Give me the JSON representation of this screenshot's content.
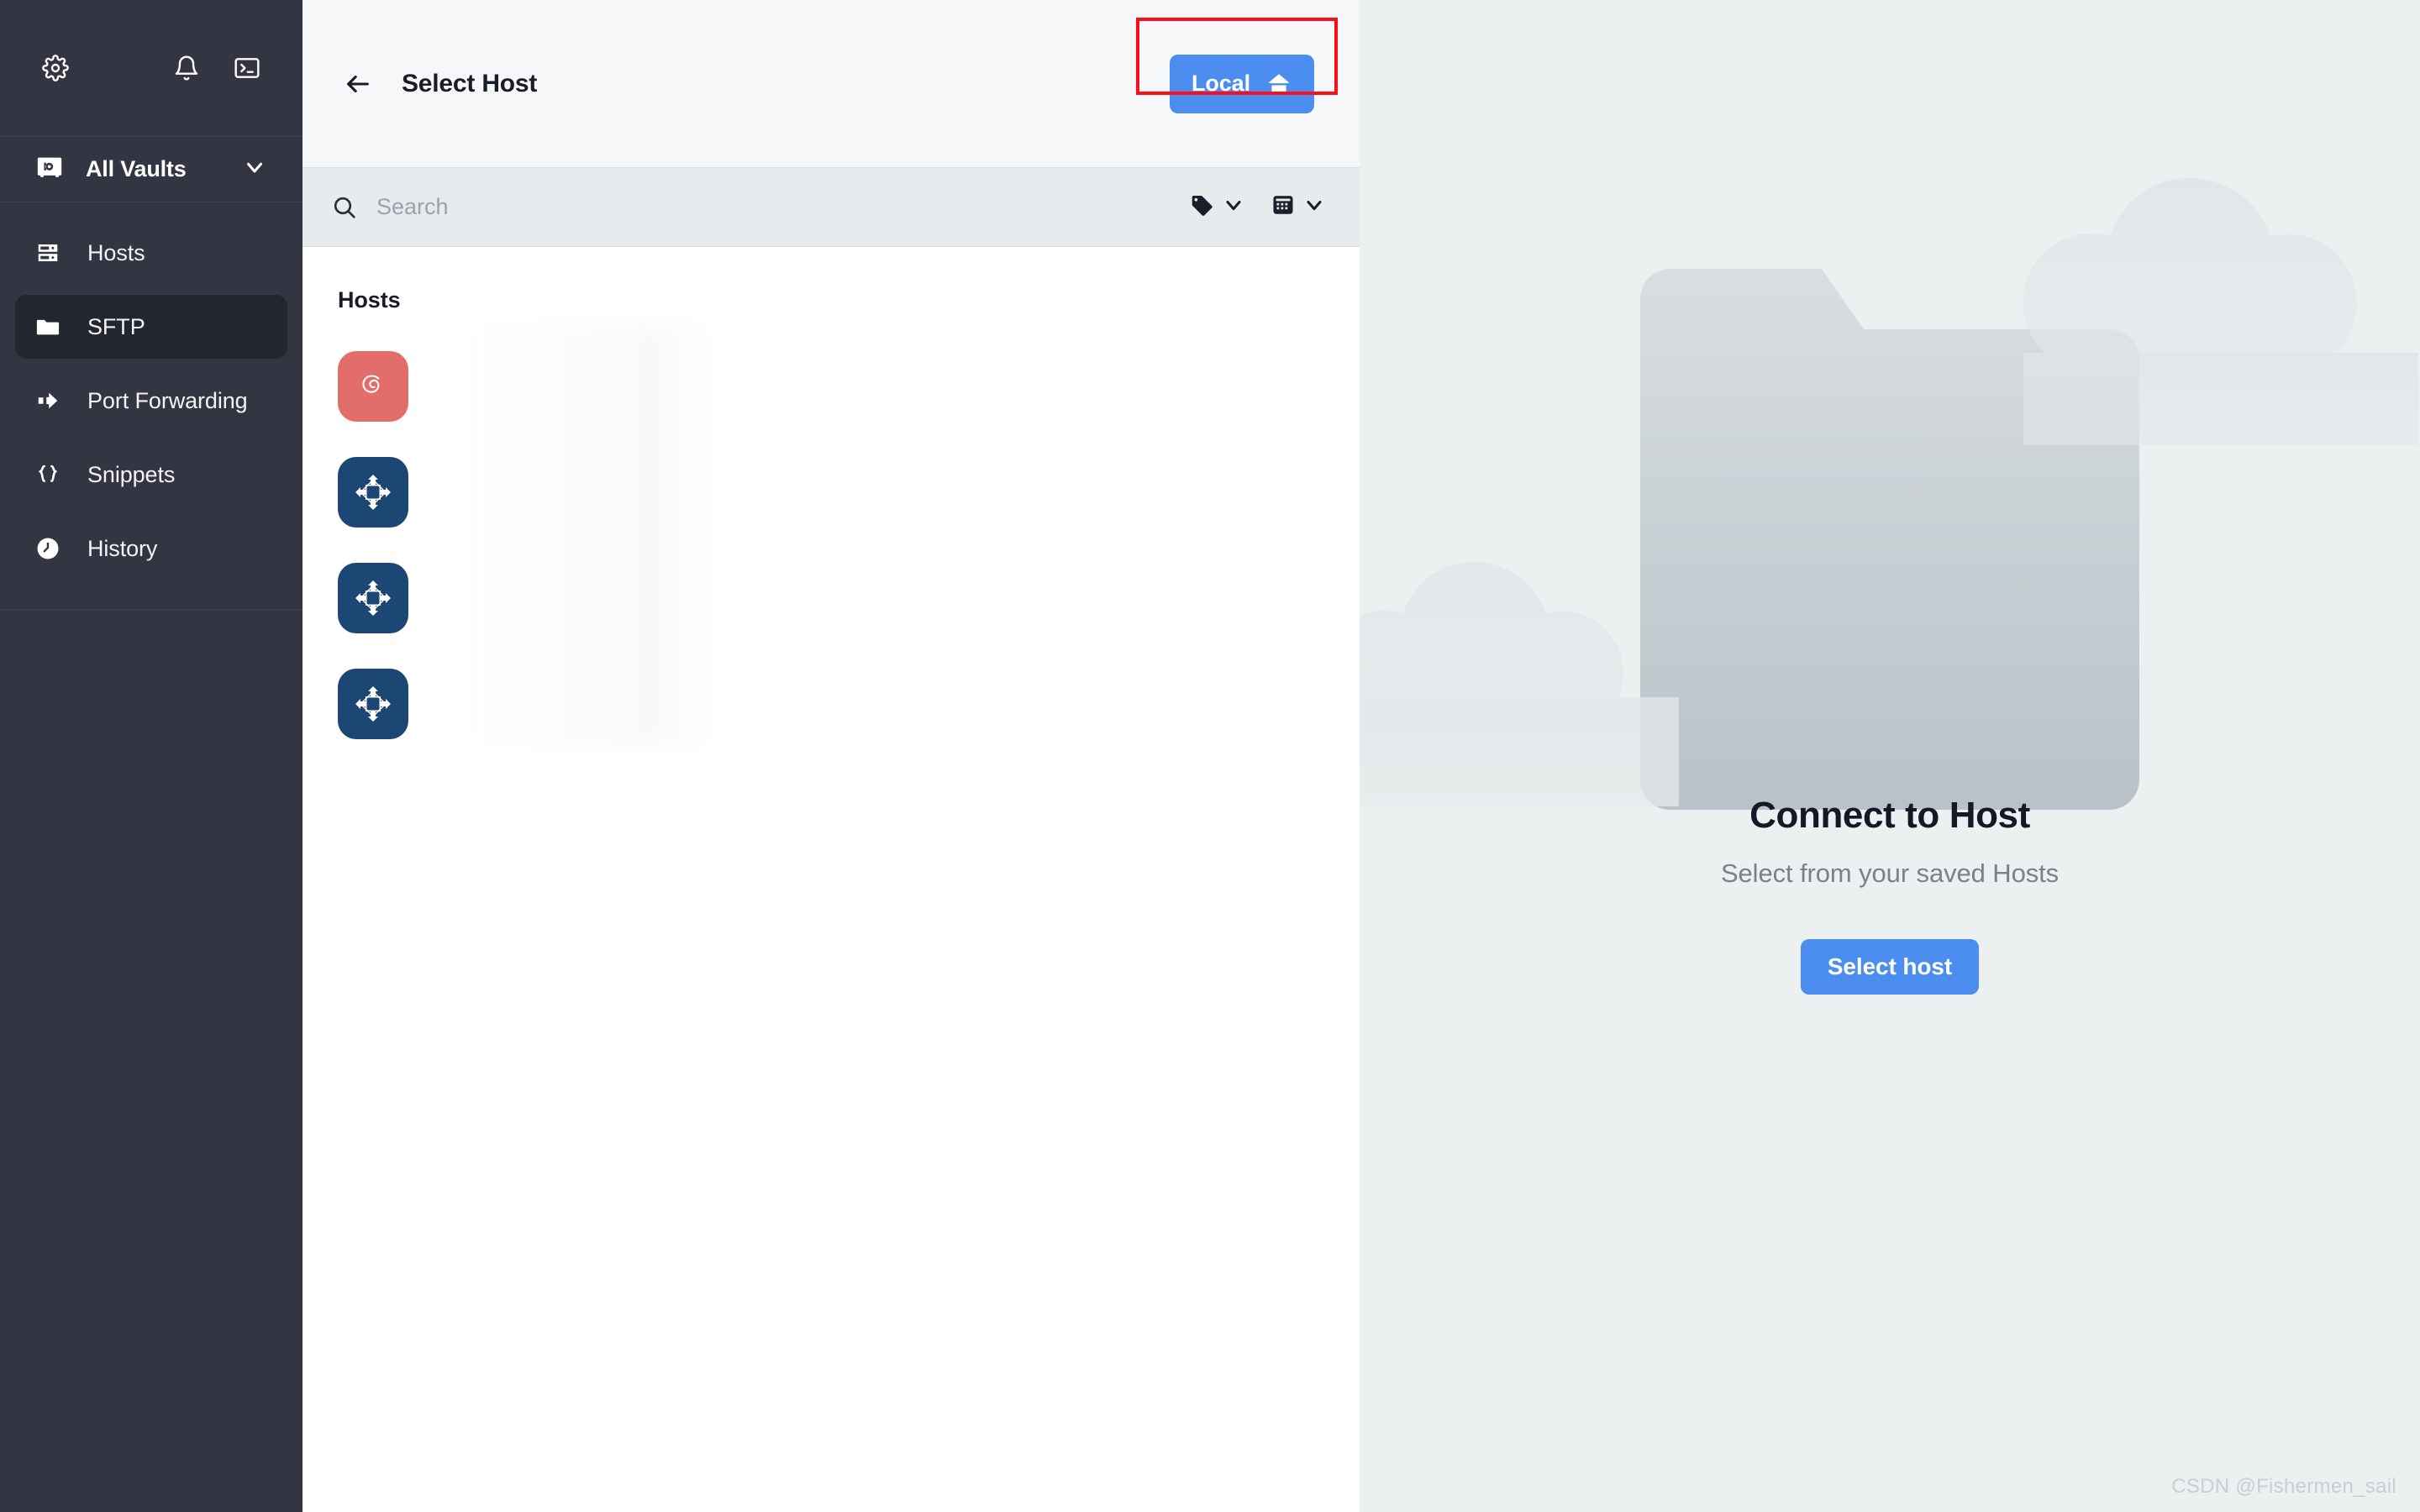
{
  "sidebar": {
    "toolbar": {
      "settings_icon": "gear-icon",
      "notifications_icon": "bell-icon",
      "terminal_icon": "terminal-icon"
    },
    "vault": {
      "icon": "vault-icon",
      "label": "All Vaults",
      "chevron": "chevron-down-icon"
    },
    "items": [
      {
        "label": "Hosts",
        "icon": "server-icon",
        "active": false
      },
      {
        "label": "SFTP",
        "icon": "folder-icon",
        "active": true
      },
      {
        "label": "Port Forwarding",
        "icon": "arrow-forward-icon",
        "active": false
      },
      {
        "label": "Snippets",
        "icon": "braces-icon",
        "active": false
      },
      {
        "label": "History",
        "icon": "clock-icon",
        "active": false
      }
    ]
  },
  "middle": {
    "header": {
      "back_icon": "arrow-left-icon",
      "title": "Select Host",
      "local_button": {
        "label": "Local",
        "icon": "home-icon",
        "color": "#4b8ef0",
        "highlight_color": "#fc0d1b"
      }
    },
    "search": {
      "icon": "search-icon",
      "placeholder": "Search",
      "value": "",
      "tag_filter": {
        "icon": "tag-icon",
        "chevron": "chevron-down-icon"
      },
      "view_mode": {
        "icon": "grid-view-icon",
        "chevron": "chevron-down-icon"
      }
    },
    "list": {
      "section_title": "Hosts",
      "rows": [
        {
          "os": "debian",
          "icon": "debian-logo-icon",
          "badge_color": "#e36d6a",
          "name": "",
          "subtitle": ""
        },
        {
          "os": "centos",
          "icon": "centos-logo-icon",
          "badge_color": "#1c4674",
          "name": "",
          "subtitle": ""
        },
        {
          "os": "centos",
          "icon": "centos-logo-icon",
          "badge_color": "#1c4674",
          "name": "",
          "subtitle": ""
        },
        {
          "os": "centos",
          "icon": "centos-logo-icon",
          "badge_color": "#1c4674",
          "name": "",
          "subtitle": ""
        }
      ]
    }
  },
  "right_panel": {
    "illustration": "folder-clouds-illustration",
    "title": "Connect to Host",
    "subtitle": "Select from your saved Hosts",
    "button_label": "Select host",
    "button_color": "#4b8ef0"
  },
  "watermark": "CSDN @Fishermen_sail"
}
